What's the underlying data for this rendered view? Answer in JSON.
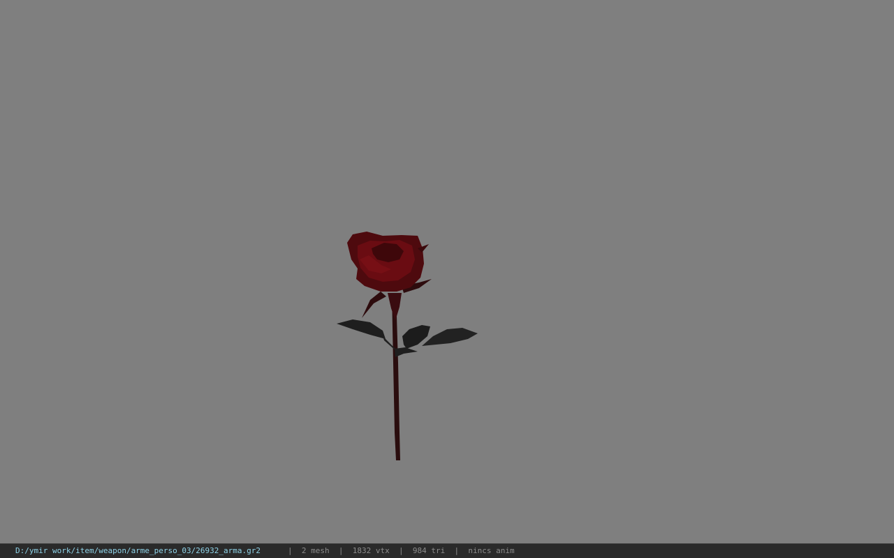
{
  "viewport": {
    "background_color": "#7f7f7f",
    "model": {
      "description_icon": "rose-model",
      "petal_color": "#5a0a0e",
      "leaf_color": "#1f1f1f",
      "stem_color": "#2a0d0e"
    }
  },
  "status_bar": {
    "file_path": "D:/ymir work/item/weapon/arme_perso_03/26932_arma.gr2",
    "separator": "|",
    "mesh_count": "2 mesh",
    "vertex_count": "1832 vtx",
    "triangle_count": "984 tri",
    "animation": "nincs anim",
    "path_color": "#8fd3e8",
    "background_color": "#2a2a2a"
  }
}
